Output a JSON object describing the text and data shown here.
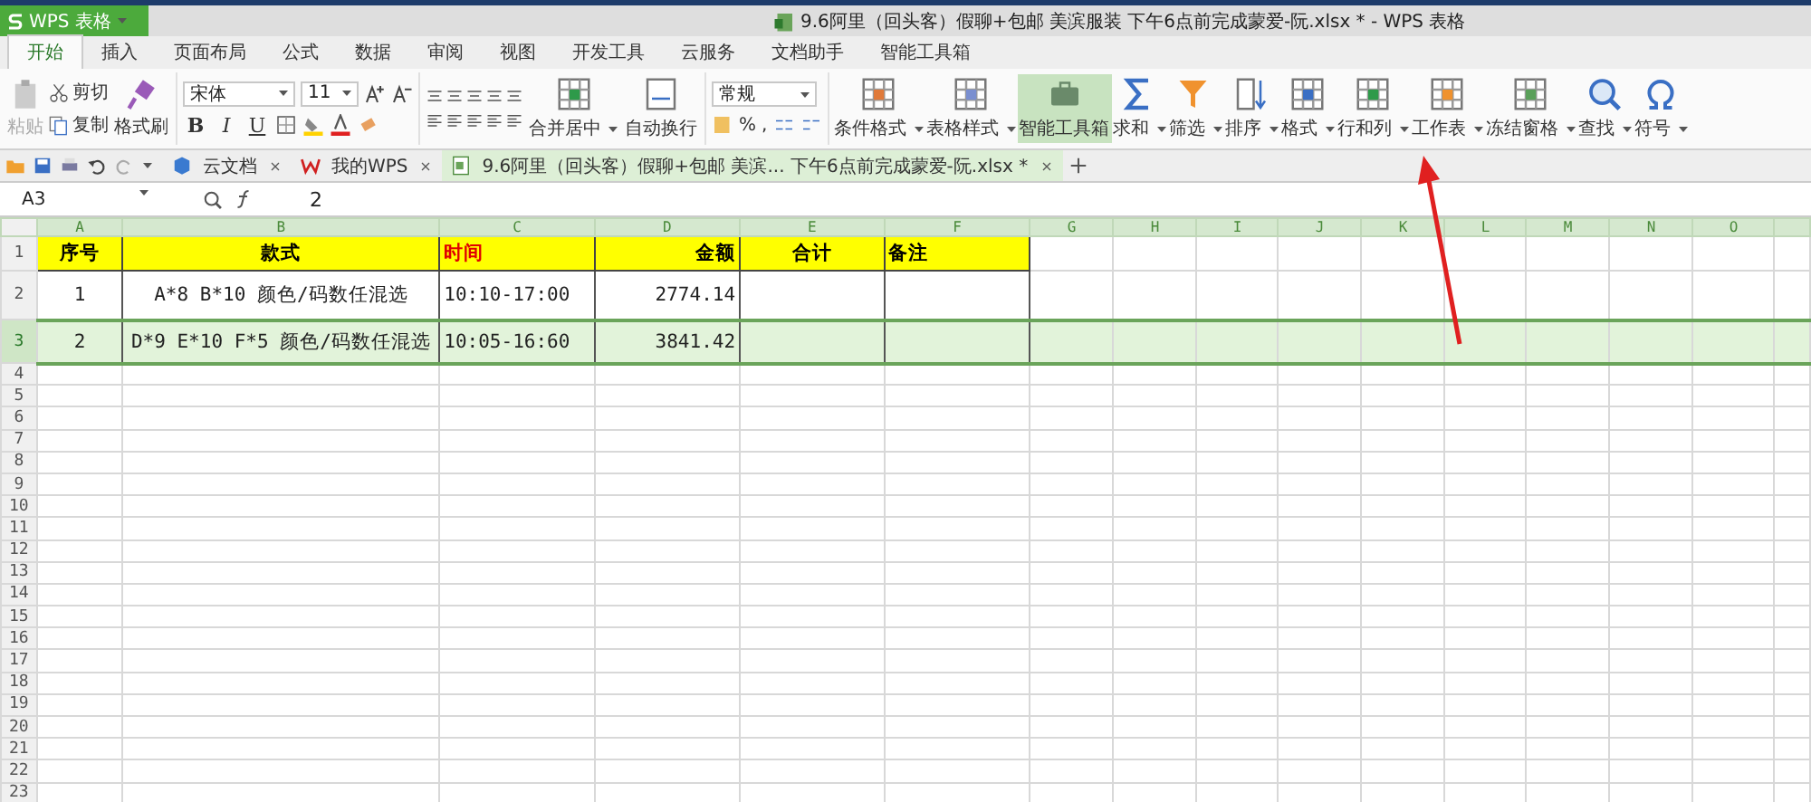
{
  "title_bar": {
    "app_button": "WPS 表格",
    "title": "9.6阿里（回头客）假聊+包邮 美滨服装 下午6点前完成蒙爱-阮.xlsx * - WPS 表格"
  },
  "menu_tabs": [
    {
      "label": "开始",
      "selected": true
    },
    {
      "label": "插入",
      "selected": false
    },
    {
      "label": "页面布局",
      "selected": false
    },
    {
      "label": "公式",
      "selected": false
    },
    {
      "label": "数据",
      "selected": false
    },
    {
      "label": "审阅",
      "selected": false
    },
    {
      "label": "视图",
      "selected": false
    },
    {
      "label": "开发工具",
      "selected": false
    },
    {
      "label": "云服务",
      "selected": false
    },
    {
      "label": "文档助手",
      "selected": false
    },
    {
      "label": "智能工具箱",
      "selected": false
    }
  ],
  "ribbon": {
    "clipboard": {
      "paste": {
        "label": "粘贴",
        "disabled": true
      },
      "cut": "剪切",
      "copy": "复制",
      "format_painter": "格式刷"
    },
    "font": {
      "font_name": "宋体",
      "font_size": "11",
      "style_buttons": [
        "B",
        "I",
        "U"
      ]
    },
    "alignment": [
      {
        "label": "合并居中",
        "dropdown": true
      },
      {
        "label": "自动换行",
        "dropdown": false
      }
    ],
    "number": {
      "format": "常规",
      "percent": "%",
      "comma": ","
    },
    "tools": [
      {
        "label": "条件格式",
        "dropdown": true,
        "selected": false
      },
      {
        "label": "表格样式",
        "dropdown": true,
        "selected": false
      },
      {
        "label": "智能工具箱",
        "dropdown": false,
        "selected": true
      },
      {
        "label": "求和",
        "dropdown": true,
        "selected": false
      },
      {
        "label": "筛选",
        "dropdown": true,
        "selected": false
      },
      {
        "label": "排序",
        "dropdown": true,
        "selected": false
      },
      {
        "label": "格式",
        "dropdown": true,
        "selected": false
      },
      {
        "label": "行和列",
        "dropdown": true,
        "selected": false
      },
      {
        "label": "工作表",
        "dropdown": true,
        "selected": false
      },
      {
        "label": "冻结窗格",
        "dropdown": true,
        "selected": false
      },
      {
        "label": "查找",
        "dropdown": true,
        "selected": false
      },
      {
        "label": "符号",
        "dropdown": true,
        "selected": false
      }
    ]
  },
  "document_tabs": [
    {
      "label": "云文档",
      "selected": false
    },
    {
      "label": "我的WPS",
      "selected": false
    },
    {
      "label": "9.6阿里（回头客）假聊+包邮 美滨... 下午6点前完成蒙爱-阮.xlsx *",
      "selected": true
    }
  ],
  "formula_bar": {
    "cell_ref": "A3",
    "value": "2"
  },
  "sheet": {
    "columns": [
      "A",
      "B",
      "C",
      "D",
      "E",
      "F",
      "G",
      "H",
      "I",
      "J",
      "K",
      "L",
      "M",
      "N",
      "O"
    ],
    "rows": [
      {
        "number": "1",
        "kind": "header",
        "selected": false,
        "cells": [
          {
            "text": "序号",
            "color": "#000000"
          },
          {
            "text": "款式",
            "color": "#000000"
          },
          {
            "text": "时间",
            "color": "#e00000"
          },
          {
            "text": "金额",
            "color": "#000000"
          },
          {
            "text": "合计",
            "color": "#000000"
          },
          {
            "text": "备注",
            "color": "#000000"
          }
        ]
      },
      {
        "number": "2",
        "kind": "data",
        "selected": false,
        "cells": [
          {
            "text": "1"
          },
          {
            "text": "A*8  B*10  颜色/码数任混选"
          },
          {
            "text": "10:10-17:00"
          },
          {
            "text": "2774.14"
          }
        ]
      },
      {
        "number": "3",
        "kind": "data",
        "selected": true,
        "cells": [
          {
            "text": "2"
          },
          {
            "text": "D*9 E*10 F*5  颜色/码数任混选"
          },
          {
            "text": "10:05-16:60"
          },
          {
            "text": "3841.42"
          }
        ]
      },
      {
        "number": "4",
        "kind": "empty",
        "selected": false,
        "cells": []
      },
      {
        "number": "5",
        "kind": "empty",
        "selected": false,
        "cells": []
      },
      {
        "number": "6",
        "kind": "empty",
        "selected": false,
        "cells": []
      },
      {
        "number": "7",
        "kind": "empty",
        "selected": false,
        "cells": []
      },
      {
        "number": "8",
        "kind": "empty",
        "selected": false,
        "cells": []
      },
      {
        "number": "9",
        "kind": "empty",
        "selected": false,
        "cells": []
      },
      {
        "number": "10",
        "kind": "empty",
        "selected": false,
        "cells": []
      },
      {
        "number": "11",
        "kind": "empty",
        "selected": false,
        "cells": []
      },
      {
        "number": "12",
        "kind": "empty",
        "selected": false,
        "cells": []
      },
      {
        "number": "13",
        "kind": "empty",
        "selected": false,
        "cells": []
      },
      {
        "number": "14",
        "kind": "empty",
        "selected": false,
        "cells": []
      },
      {
        "number": "15",
        "kind": "empty",
        "selected": false,
        "cells": []
      },
      {
        "number": "16",
        "kind": "empty",
        "selected": false,
        "cells": []
      },
      {
        "number": "17",
        "kind": "empty",
        "selected": false,
        "cells": []
      },
      {
        "number": "18",
        "kind": "empty",
        "selected": false,
        "cells": []
      },
      {
        "number": "19",
        "kind": "empty",
        "selected": false,
        "cells": []
      },
      {
        "number": "20",
        "kind": "empty",
        "selected": false,
        "cells": []
      },
      {
        "number": "21",
        "kind": "empty",
        "selected": false,
        "cells": []
      },
      {
        "number": "22",
        "kind": "empty",
        "selected": false,
        "cells": []
      },
      {
        "number": "23",
        "kind": "empty",
        "selected": false,
        "cells": []
      }
    ]
  }
}
